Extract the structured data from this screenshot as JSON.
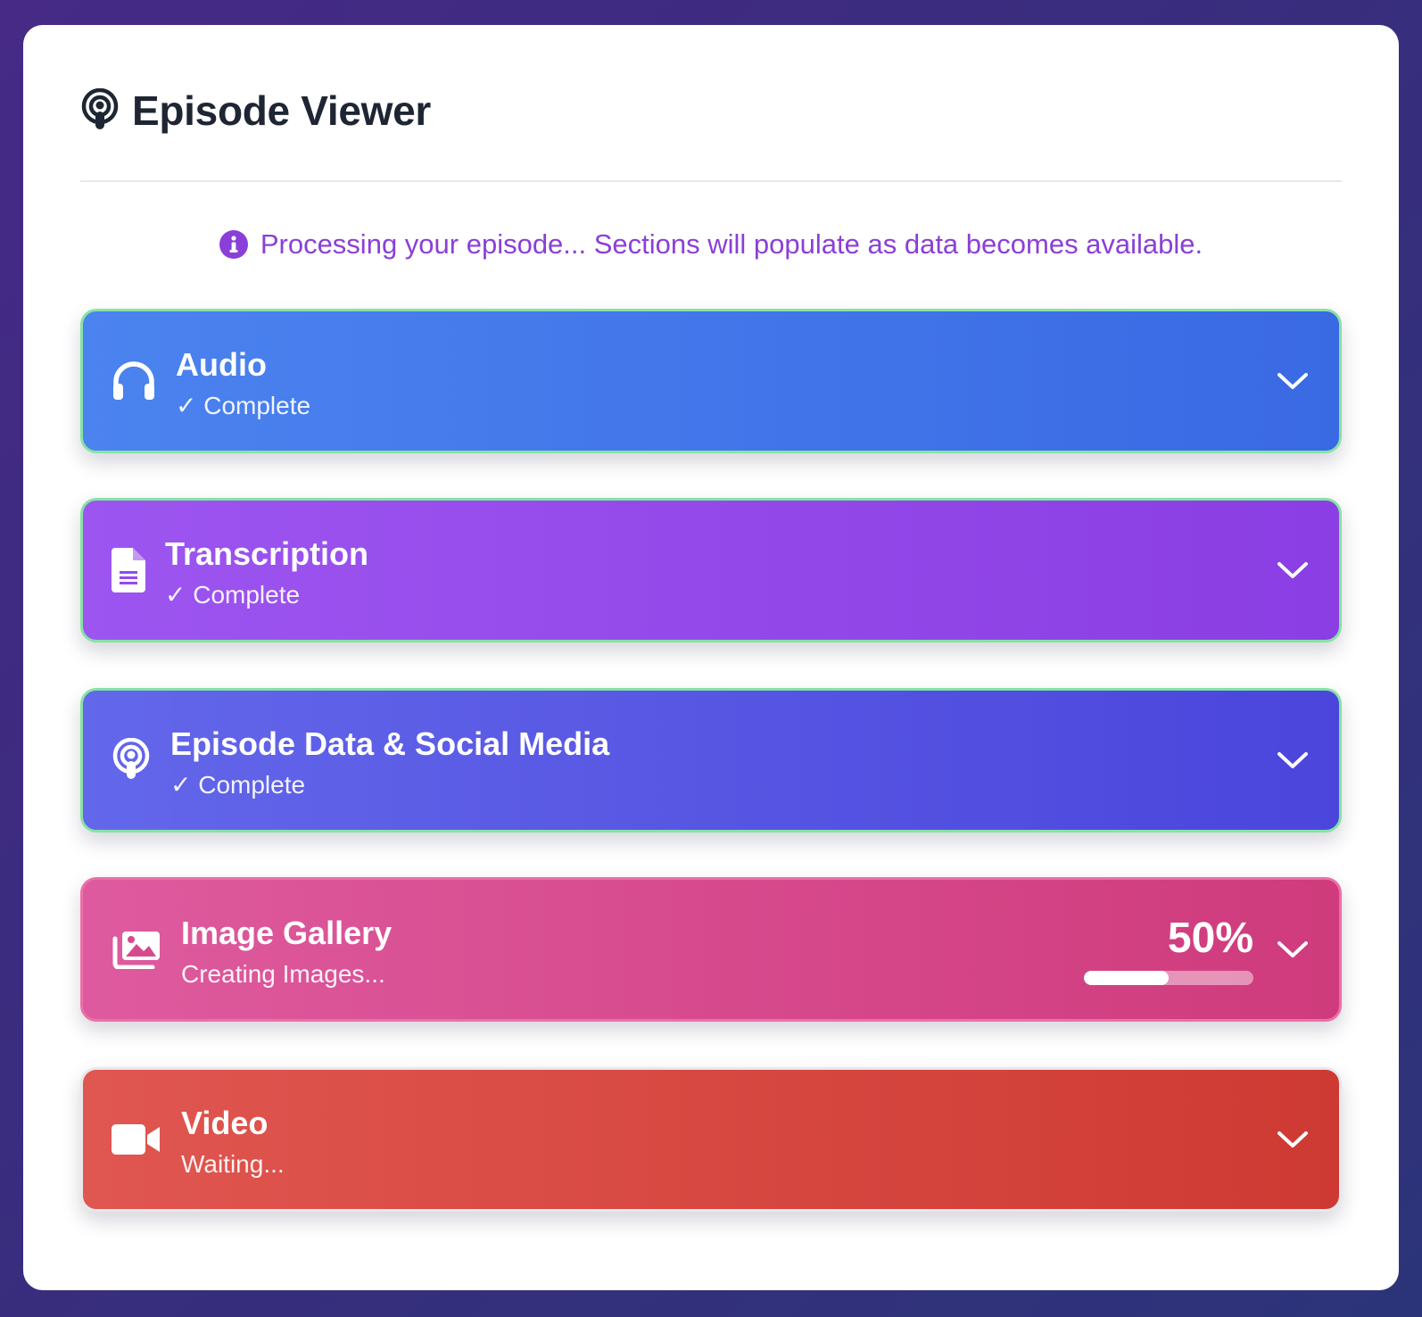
{
  "header": {
    "title": "Episode Viewer",
    "icon": "podcast-icon"
  },
  "notice": {
    "text": "Processing your episode... Sections will populate as data becomes available.",
    "icon": "info-circle-icon",
    "color": "#8a3fd9"
  },
  "sections": [
    {
      "title": "Audio",
      "status": "✓ Complete",
      "state": "complete",
      "icon": "headphones-icon",
      "color": "#4478ea"
    },
    {
      "title": "Transcription",
      "status": "✓ Complete",
      "state": "complete",
      "icon": "document-icon",
      "color": "#9449ea"
    },
    {
      "title": "Episode Data & Social Media",
      "status": "✓ Complete",
      "state": "complete",
      "icon": "podcast-icon",
      "color": "#5756e2"
    },
    {
      "title": "Image Gallery",
      "status": "Creating Images...",
      "state": "in-progress",
      "icon": "images-icon",
      "color": "#d64a8d",
      "progress_label": "50%",
      "progress": 0.5
    },
    {
      "title": "Video",
      "status": "Waiting...",
      "state": "waiting",
      "icon": "video-camera-icon",
      "color": "#d84841"
    }
  ],
  "colors": {
    "complete_border": "#86e2a6",
    "in_progress_border": "#ec6fa7",
    "waiting_border": "#e8e8ea"
  }
}
